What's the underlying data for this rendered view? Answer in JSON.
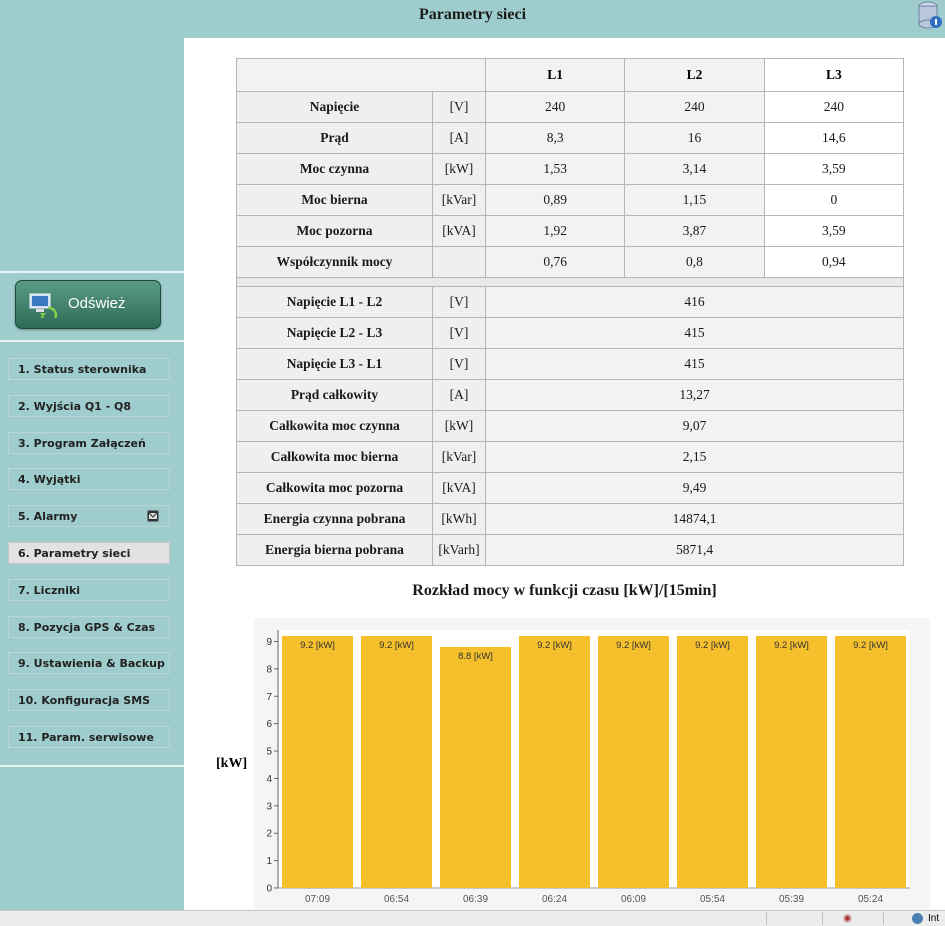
{
  "header": {
    "title": "Parametry sieci"
  },
  "sidebar": {
    "refresh_label": "Odśwież",
    "items": [
      {
        "label": "1. Status sterownika"
      },
      {
        "label": "2. Wyjścia Q1 - Q8"
      },
      {
        "label": "3. Program Załączeń"
      },
      {
        "label": "4. Wyjątki"
      },
      {
        "label": "5. Alarmy",
        "icon": "mail-icon"
      },
      {
        "label": "6. Parametry sieci",
        "active": true
      },
      {
        "label": "7. Liczniki"
      },
      {
        "label": "8. Pozycja GPS & Czas"
      },
      {
        "label": "9. Ustawienia & Backup"
      },
      {
        "label": "10. Konfiguracja SMS"
      },
      {
        "label": "11. Param. serwisowe"
      }
    ]
  },
  "table": {
    "columns": [
      "L1",
      "L2",
      "L3"
    ],
    "phase_rows": [
      {
        "name": "Napięcie",
        "unit": "[V]",
        "values": [
          "240",
          "240",
          "240"
        ]
      },
      {
        "name": "Prąd",
        "unit": "[A]",
        "values": [
          "8,3",
          "16",
          "14,6"
        ]
      },
      {
        "name": "Moc czynna",
        "unit": "[kW]",
        "values": [
          "1,53",
          "3,14",
          "3,59"
        ]
      },
      {
        "name": "Moc bierna",
        "unit": "[kVar]",
        "values": [
          "0,89",
          "1,15",
          "0"
        ]
      },
      {
        "name": "Moc pozorna",
        "unit": "[kVA]",
        "values": [
          "1,92",
          "3,87",
          "3,59"
        ]
      },
      {
        "name": "Współczynnik mocy",
        "unit": "",
        "values": [
          "0,76",
          "0,8",
          "0,94"
        ]
      }
    ],
    "total_rows": [
      {
        "name": "Napięcie L1 - L2",
        "unit": "[V]",
        "value": "416"
      },
      {
        "name": "Napięcie L2 - L3",
        "unit": "[V]",
        "value": "415"
      },
      {
        "name": "Napięcie L3 - L1",
        "unit": "[V]",
        "value": "415"
      },
      {
        "name": "Prąd całkowity",
        "unit": "[A]",
        "value": "13,27"
      },
      {
        "name": "Całkowita moc czynna",
        "unit": "[kW]",
        "value": "9,07"
      },
      {
        "name": "Całkowita moc bierna",
        "unit": "[kVar]",
        "value": "2,15"
      },
      {
        "name": "Całkowita moc pozorna",
        "unit": "[kVA]",
        "value": "9,49"
      },
      {
        "name": "Energia czynna pobrana",
        "unit": "[kWh]",
        "value": "14874,1"
      },
      {
        "name": "Energia bierna pobrana",
        "unit": "[kVarh]",
        "value": "5871,4"
      }
    ]
  },
  "chart_data": {
    "type": "bar",
    "title": "Rozkład mocy w funkcji czasu [kW]/[15min]",
    "ylabel": "[kW]",
    "categories": [
      "07:09",
      "06:54",
      "06:39",
      "06:24",
      "06:09",
      "05:54",
      "05:39",
      "05:24"
    ],
    "values": [
      9.2,
      9.2,
      8.8,
      9.2,
      9.2,
      9.2,
      9.2,
      9.2
    ],
    "data_labels": [
      "9.2 [kW]",
      "9.2 [kW]",
      "8.8 [kW]",
      "9.2 [kW]",
      "9.2 [kW]",
      "9.2 [kW]",
      "9.2 [kW]",
      "9.2 [kW]"
    ],
    "yticks": [
      0,
      1,
      2,
      3,
      4,
      5,
      6,
      7,
      8,
      9
    ],
    "ylim": [
      0,
      9.2
    ],
    "color": "#f5c02c"
  },
  "statusbar": {
    "text": "Int"
  }
}
